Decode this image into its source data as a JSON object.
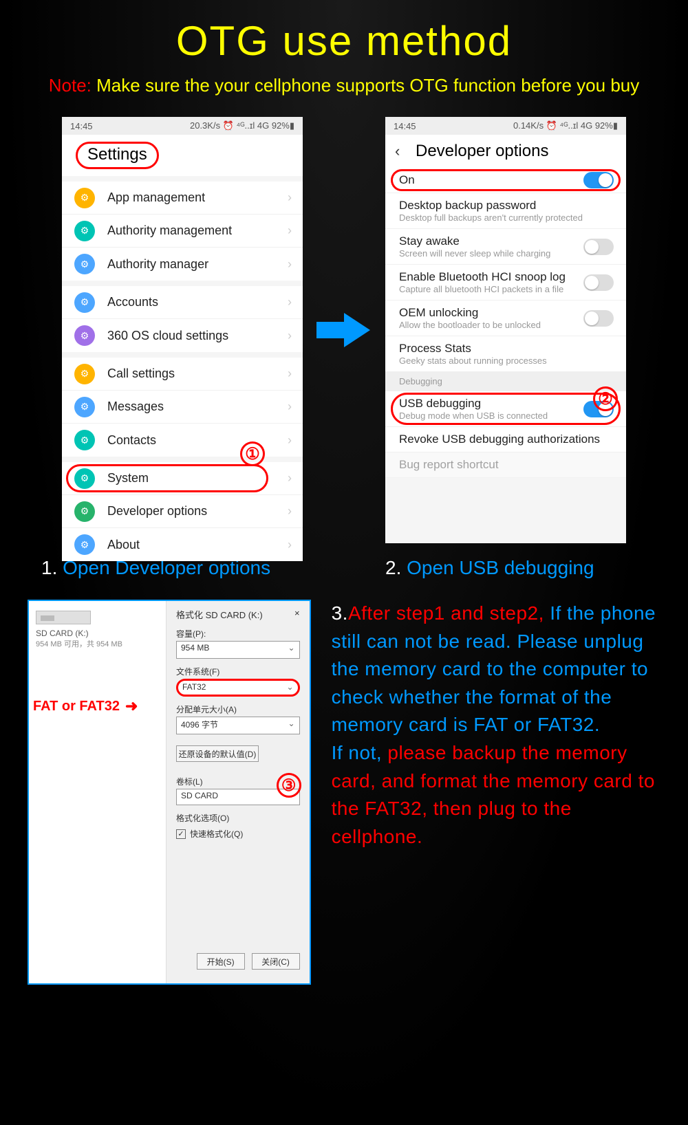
{
  "title": "OTG use method",
  "note_label": "Note:",
  "note_text": "Make sure the your cellphone supports OTG function before you buy",
  "status_time": "14:45",
  "status_right_1": "20.3K/s ⏰ ⁴ᴳ..ɪl 4G 92%▮",
  "status_right_2": "0.14K/s ⏰ ⁴ᴳ..ɪl 4G 92%▮",
  "phone1": {
    "header": "Settings",
    "groups": [
      [
        {
          "label": "App management",
          "color": "#ffb400"
        },
        {
          "label": "Authority management",
          "color": "#00c4b4"
        },
        {
          "label": "Authority manager",
          "color": "#4da6ff"
        }
      ],
      [
        {
          "label": "Accounts",
          "color": "#4da6ff"
        },
        {
          "label": "360 OS cloud settings",
          "color": "#a070e8"
        }
      ],
      [
        {
          "label": "Call settings",
          "color": "#ffb400"
        },
        {
          "label": "Messages",
          "color": "#4da6ff"
        },
        {
          "label": "Contacts",
          "color": "#00c4b4"
        }
      ],
      [
        {
          "label": "System",
          "color": "#00c4b4",
          "highlight": true
        },
        {
          "label": "Developer options",
          "color": "#27b36b"
        },
        {
          "label": "About",
          "color": "#4da6ff"
        }
      ]
    ],
    "badge1": "①"
  },
  "phone2": {
    "header": "Developer options",
    "rows": [
      {
        "title": "On",
        "toggle": "on",
        "highlight": true
      },
      {
        "title": "Desktop backup password",
        "sub": "Desktop full backups aren't currently protected"
      },
      {
        "title": "Stay awake",
        "sub": "Screen will never sleep while charging",
        "toggle": "off"
      },
      {
        "title": "Enable Bluetooth HCI snoop log",
        "sub": "Capture all bluetooth HCI packets in a file",
        "toggle": "off"
      },
      {
        "title": "OEM unlocking",
        "sub": "Allow the bootloader to be unlocked",
        "toggle": "off"
      },
      {
        "title": "Process Stats",
        "sub": "Geeky stats about running processes"
      }
    ],
    "section_label": "Debugging",
    "rows2": [
      {
        "title": "USB debugging",
        "sub": "Debug mode when USB is connected",
        "toggle": "on",
        "highlight": true
      },
      {
        "title": "Revoke USB debugging authorizations"
      },
      {
        "title": "Bug report shortcut",
        "faded": true
      }
    ],
    "badge2": "②"
  },
  "captions": {
    "c1_n": "1.",
    "c1_t": "Open Developer options",
    "c2_n": "2.",
    "c2_t": "Open USB debugging"
  },
  "format_panel": {
    "left_title": "SD CARD (K:)",
    "left_sub": "954 MB 可用，共 954 MB",
    "right_title": "格式化 SD CARD (K:)",
    "close": "×",
    "capacity_label": "容量(P):",
    "capacity_value": "954 MB",
    "fs_label": "文件系统(F)",
    "fs_value": "FAT32",
    "alloc_label": "分配单元大小(A)",
    "alloc_value": "4096 字节",
    "restore_btn": "还原设备的默认值(D)",
    "volume_label": "卷标(L)",
    "volume_value": "SD CARD",
    "opts_label": "格式化选项(O)",
    "quick_label": "快速格式化(Q)",
    "start_btn": "开始(S)",
    "close_btn": "关闭(C)",
    "fat_label": "FAT or FAT32",
    "arrow": "➜",
    "badge3": "③"
  },
  "step3": {
    "n": "3.",
    "red1": "After step1 and step2,",
    "blue1": "If the phone still can not be read. Please unplug the memory card to the computer to check whether the format of the memory card is FAT or FAT32.",
    "blue2": "If not, ",
    "red2": "please backup the memory card, and format the memory card to the FAT32, then plug to the cellphone."
  }
}
